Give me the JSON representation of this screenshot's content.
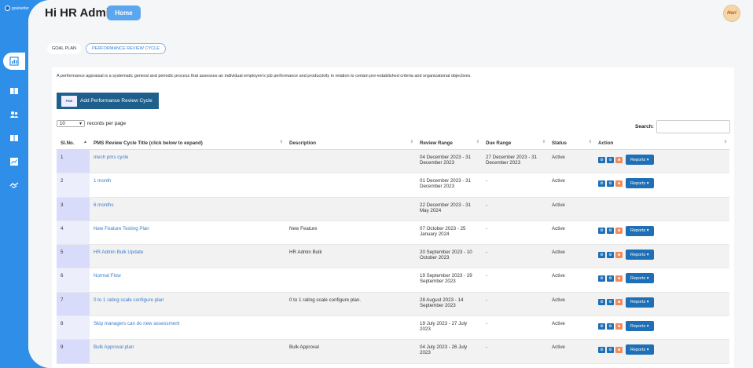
{
  "app": {
    "logo_text": "goalsetter"
  },
  "header": {
    "greeting": "Hi HR Admin",
    "home_label": "Home",
    "avatar_text": "Hari"
  },
  "tabs": [
    {
      "label": "GOAL PLAN"
    },
    {
      "label": "PERFORMANCE REVIEW CYCLE"
    }
  ],
  "main": {
    "description": "A performance appraisal is a systematic general and periodic process that assesses an individual employee's job performance and productivity in relation to certain pre-established criteria and organizational objectives.",
    "add_button_label": "Add Performance Review Cycle",
    "add_button_icon_text": "PMS",
    "per_page_value": "10",
    "per_page_label": "records per page",
    "search_label": "Search:"
  },
  "table": {
    "columns": [
      "Sl.No.",
      "PMS Review Cycle Title (click below to expand)",
      "Description",
      "Review Range",
      "Due Range",
      "Status",
      "Action"
    ],
    "reports_label": "Reports",
    "rows": [
      {
        "sl": "1",
        "title": "mech pms cycle",
        "desc": "",
        "review": "04 December 2023 - 31 December 2023",
        "due": "27 December 2023 - 31 December 2023",
        "status": "Active",
        "actions": true
      },
      {
        "sl": "2",
        "title": "1 month",
        "desc": "",
        "review": "01 December 2023 - 31 December 2023",
        "due": "-",
        "status": "Active",
        "actions": true
      },
      {
        "sl": "3",
        "title": "6 months",
        "desc": "",
        "review": "22 December 2023 - 31 May 2024",
        "due": "-",
        "status": "Active",
        "actions": false
      },
      {
        "sl": "4",
        "title": "New Feature Testing Plan",
        "desc": "New Feature",
        "review": "07 October 2023 - 25 January 2024",
        "due": "-",
        "status": "Active",
        "actions": true
      },
      {
        "sl": "5",
        "title": "HR Admin Bulk Update",
        "desc": "HR Admin Bulk",
        "review": "20 September 2023 - 10 October 2023",
        "due": "-",
        "status": "Active",
        "actions": true
      },
      {
        "sl": "6",
        "title": "Normal Flow",
        "desc": "",
        "review": "19 September 2023 - 29 September 2023",
        "due": "-",
        "status": "Active",
        "actions": true
      },
      {
        "sl": "7",
        "title": "0 to 1 rating scale configure plan",
        "desc": "0 to 1 rating scale configure plan.",
        "review": "28 August 2023 - 14 September 2023",
        "due": "-",
        "status": "Active",
        "actions": true
      },
      {
        "sl": "8",
        "title": "Skip managers can do new assessment",
        "desc": "",
        "review": "19 July 2023 - 27 July 2023",
        "due": "-",
        "status": "Active",
        "actions": true
      },
      {
        "sl": "9",
        "title": "Bulk Approval plan",
        "desc": "Bulk Approval",
        "review": "04 July 2023 - 26 July 2023",
        "due": "-",
        "status": "Active",
        "actions": true
      }
    ]
  }
}
